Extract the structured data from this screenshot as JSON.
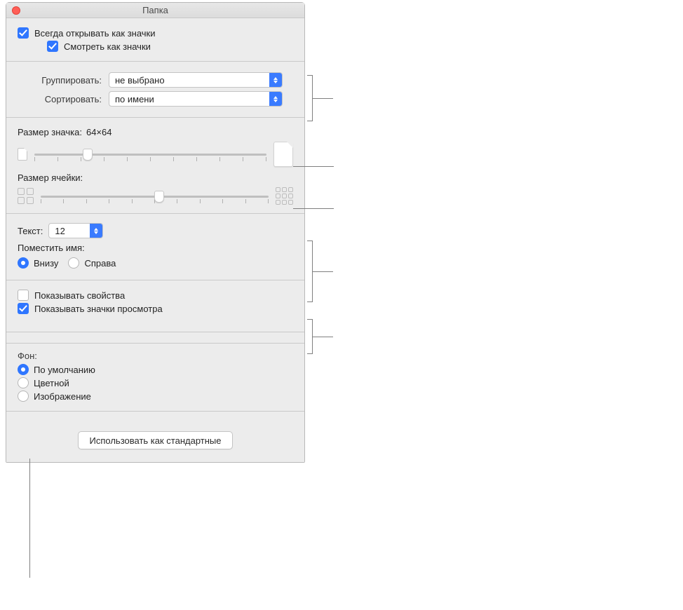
{
  "window": {
    "title": "Папка"
  },
  "open": {
    "always_as_icons": "Всегда открывать как значки",
    "view_as_icons": "Смотреть как значки"
  },
  "grouping": {
    "group_label": "Группировать:",
    "group_value": "не выбрано",
    "sort_label": "Сортировать:",
    "sort_value": "по имени"
  },
  "icon_size": {
    "label": "Размер значка:",
    "value": "64×64",
    "label_grid": "Размер ячейки:"
  },
  "text": {
    "label": "Текст:",
    "size": "12",
    "place_label": "Поместить имя:",
    "bottom": "Внизу",
    "right": "Справа"
  },
  "show": {
    "properties": "Показывать свойства",
    "preview": "Показывать значки просмотра"
  },
  "extra_margin": {
    "text": ""
  },
  "background": {
    "label": "Фон:",
    "default": "По умолчанию",
    "color": "Цветной",
    "image": "Изображение"
  },
  "footer": {
    "use_as_default": "Использовать как стандартные"
  }
}
